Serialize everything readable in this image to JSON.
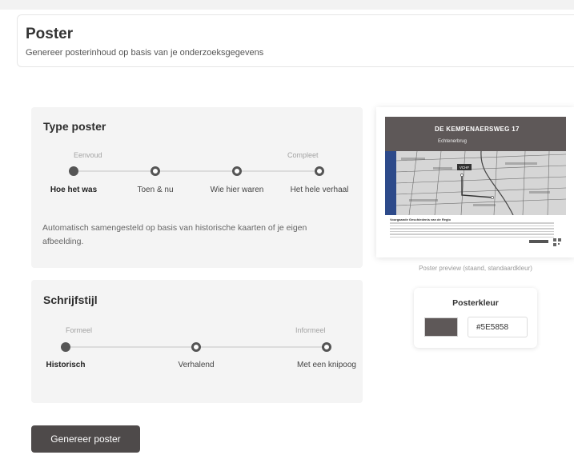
{
  "header": {
    "title": "Poster",
    "subtitle": "Genereer posterinhoud op basis van je onderzoeksgegevens"
  },
  "type_poster": {
    "title": "Type poster",
    "hint_left": "Eenvoud",
    "hint_right": "Compleet",
    "options": [
      "Hoe het was",
      "Toen & nu",
      "Wie hier waren",
      "Het hele verhaal"
    ],
    "selected": "Hoe het was",
    "description": "Automatisch samengesteld op basis van historische kaarten of je eigen afbeelding."
  },
  "schrijfstijl": {
    "title": "Schrijfstijl",
    "hint_left": "Formeel",
    "hint_right": "Informeel",
    "options": [
      "Historisch",
      "Verhalend",
      "Met een knipoog"
    ],
    "selected": "Historisch"
  },
  "generate_button": "Genereer poster",
  "preview": {
    "poster_title": "DE KEMPENAERSWEG 17",
    "poster_subtitle": "Echtenerbrug",
    "poster_marker": "VCHF",
    "poster_caption": "Voorgaande Geschiedenis van de Regio",
    "label": "Poster preview (staand, standaardkleur)"
  },
  "posterkleur": {
    "title": "Posterkleur",
    "hex": "#5E5858",
    "swatch_color": "#5e5858"
  }
}
